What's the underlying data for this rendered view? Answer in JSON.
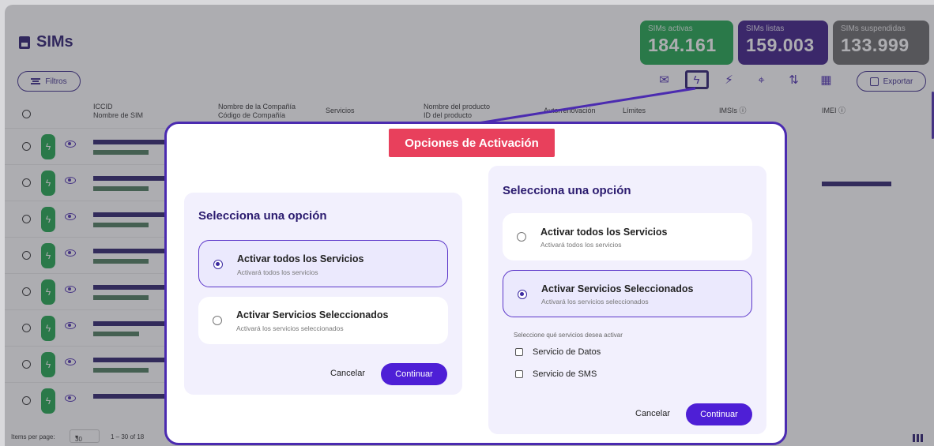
{
  "app": {
    "title": "SIMs",
    "filters_label": "Filtros",
    "export_label": "Exportar",
    "stats": [
      {
        "label": "SIMs activas",
        "value": "184.161",
        "color": "#1ea54c"
      },
      {
        "label": "SIMs listas",
        "value": "159.003",
        "color": "#3b1a86"
      },
      {
        "label": "SIMs suspendidas",
        "value": "133.999",
        "color": "#6a6a6a"
      }
    ],
    "toolbar_icons": [
      "mail-icon",
      "bolt-icon",
      "deactivate-icon",
      "location-icon",
      "chart-icon",
      "gift-icon"
    ],
    "columns": {
      "iccid": "ICCID",
      "sim_name": "Nombre de SIM",
      "company_name": "Nombre de la Compañía",
      "company_code": "Código de Compañía",
      "services": "Servicios",
      "product_name": "Nombre del producto",
      "product_id": "ID del producto",
      "autorenewal": "Autorrenovación",
      "limits": "Límites",
      "imsis": "IMSIs ⓘ",
      "imei": "IMEI ⓘ"
    },
    "pager": {
      "items_per_page_label": "Items per page:",
      "items_per_page_value": "30",
      "range": "1 – 30 of 18"
    }
  },
  "dialog": {
    "title": "Opciones de Activación",
    "left": {
      "heading": "Selecciona una opción",
      "options": [
        {
          "title": "Activar todos los Servicios",
          "subtitle": "Activará todos los servicios",
          "selected": true
        },
        {
          "title": "Activar Servicios Seleccionados",
          "subtitle": "Activará los servicios seleccionados",
          "selected": false
        }
      ],
      "cancel": "Cancelar",
      "continue": "Continuar"
    },
    "right": {
      "heading": "Selecciona una opción",
      "options": [
        {
          "title": "Activar todos los Servicios",
          "subtitle": "Activará todos los servicios",
          "selected": false
        },
        {
          "title": "Activar Servicios Seleccionados",
          "subtitle": "Activará los servicios seleccionados",
          "selected": true
        }
      ],
      "services_prompt": "Seleccione qué servicios desea activar",
      "services": [
        "Servicio de Datos",
        "Servicio de SMS"
      ],
      "cancel": "Cancelar",
      "continue": "Continuar"
    }
  }
}
